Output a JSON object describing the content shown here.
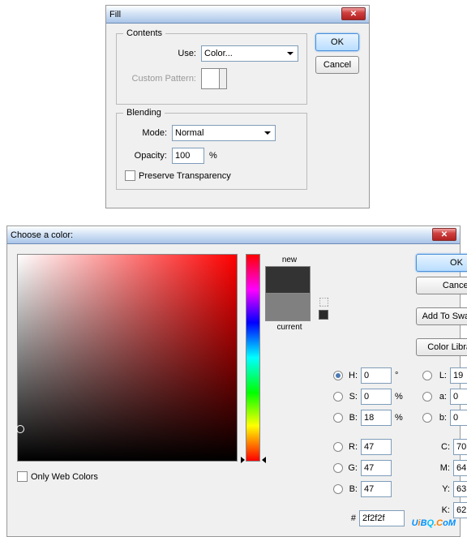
{
  "fill": {
    "title": "Fill",
    "ok": "OK",
    "cancel": "Cancel",
    "contents": {
      "legend": "Contents",
      "use_label": "Use:",
      "use_value": "Color...",
      "pattern_label": "Custom Pattern:"
    },
    "blending": {
      "legend": "Blending",
      "mode_label": "Mode:",
      "mode_value": "Normal",
      "opacity_label": "Opacity:",
      "opacity_value": "100",
      "opacity_unit": "%",
      "preserve_label": "Preserve Transparency"
    }
  },
  "cp": {
    "title": "Choose a color:",
    "new_label": "new",
    "current_label": "current",
    "new_color": "#333333",
    "current_color": "#808080",
    "ok": "OK",
    "cancel": "Cancel",
    "add_swatches": "Add To Swatches",
    "libraries": "Color Libraries",
    "only_web": "Only Web Colors",
    "hex_label": "#",
    "hex_value": "2f2f2f",
    "fields": {
      "H": {
        "label": "H:",
        "value": "0",
        "unit": "°"
      },
      "S": {
        "label": "S:",
        "value": "0",
        "unit": "%"
      },
      "Bv": {
        "label": "B:",
        "value": "18",
        "unit": "%"
      },
      "R": {
        "label": "R:",
        "value": "47",
        "unit": ""
      },
      "G": {
        "label": "G:",
        "value": "47",
        "unit": ""
      },
      "Bb": {
        "label": "B:",
        "value": "47",
        "unit": ""
      },
      "L": {
        "label": "L:",
        "value": "19",
        "unit": ""
      },
      "a": {
        "label": "a:",
        "value": "0",
        "unit": ""
      },
      "b": {
        "label": "b:",
        "value": "0",
        "unit": ""
      },
      "C": {
        "label": "C:",
        "value": "70",
        "unit": "%"
      },
      "M": {
        "label": "M:",
        "value": "64",
        "unit": "%"
      },
      "Y": {
        "label": "Y:",
        "value": "63",
        "unit": "%"
      },
      "K": {
        "label": "K:",
        "value": "62",
        "unit": "%"
      }
    }
  },
  "watermark": {
    "a": "U",
    "b": "i",
    "c": "B",
    "d": "Q",
    "e": ".C",
    "f": "oM"
  }
}
